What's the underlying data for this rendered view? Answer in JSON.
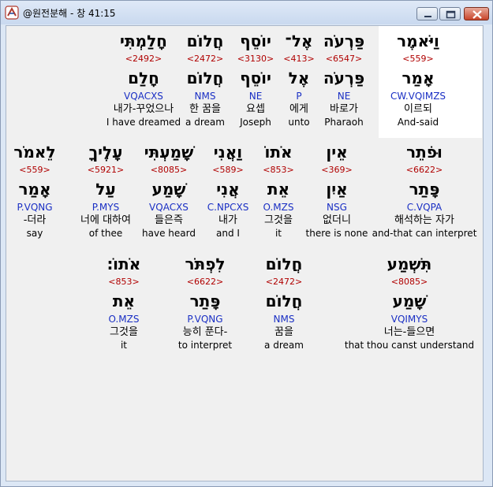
{
  "window": {
    "title": "@원전분해 - 창 41:15",
    "controls": {
      "minimize_icon": "minimize-icon",
      "maximize_icon": "maximize-icon",
      "close_icon": "close-icon"
    },
    "accent": "#c9442a"
  },
  "colors": {
    "strong": "#b00000",
    "parse": "#1a2fc4",
    "highlight": "#ffffff"
  },
  "rows": [
    [
      {
        "heb": "וַיֹּאמֶר",
        "num": "<559>",
        "lemma": "אָמַר",
        "parse": "CW.VQIMZS",
        "kor": "이르되",
        "eng": "And-said",
        "selected": true
      },
      {
        "heb": "פַּרְעֹה",
        "num": "<6547>",
        "lemma": "פַּרְעֹה",
        "parse": "NE",
        "kor": "바로가",
        "eng": "Pharaoh"
      },
      {
        "heb": "אֶל־",
        "num": "<413>",
        "lemma": "אֶל",
        "parse": "P",
        "kor": "에게",
        "eng": "unto"
      },
      {
        "heb": "יוֹסֵף",
        "num": "<3130>",
        "lemma": "יוֹסֵף",
        "parse": "NE",
        "kor": "요셉",
        "eng": "Joseph"
      },
      {
        "heb": "חֲלוֹם",
        "num": "<2472>",
        "lemma": "חֲלוֹם",
        "parse": "NMS",
        "kor": "한 꿈을",
        "eng": "a dream"
      },
      {
        "heb": "חָלַמְתִּי",
        "num": "<2492>",
        "lemma": "חָלַם",
        "parse": "VQACXS",
        "kor": "내가-꾸었으나",
        "eng": "I have dreamed"
      }
    ],
    [
      {
        "heb": "וּפֹתֵר",
        "num": "<6622>",
        "lemma": "פָּתַר",
        "parse": "C.VQPA",
        "kor": "해석하는 자가",
        "eng": "and-that can interpret"
      },
      {
        "heb": "אֵין",
        "num": "<369>",
        "lemma": "אַיִן",
        "parse": "NSG",
        "kor": "없더니",
        "eng": "there is none"
      },
      {
        "heb": "אֹתוֹ",
        "num": "<853>",
        "lemma": "אֵת",
        "parse": "O.MZS",
        "kor": "그것을",
        "eng": "it"
      },
      {
        "heb": "וַאֲנִי",
        "num": "<589>",
        "lemma": "אֲנִי",
        "parse": "C.NPCXS",
        "kor": "내가",
        "eng": "and I"
      },
      {
        "heb": "שָׁמַעְתִּי",
        "num": "<8085>",
        "lemma": "שָׁמַע",
        "parse": "VQACXS",
        "kor": "들은즉",
        "eng": "have heard"
      },
      {
        "heb": "עָלֶיךָ",
        "num": "<5921>",
        "lemma": "עַל",
        "parse": "P.MYS",
        "kor": "너에 대하여",
        "eng": "of thee"
      },
      {
        "heb": "לֵאמֹר",
        "num": "<559>",
        "lemma": "אָמַר",
        "parse": "P.VQNG",
        "kor": "-더라",
        "eng": "say"
      }
    ],
    [
      {
        "heb": "תִּשְׁמַע",
        "num": "<8085>",
        "lemma": "שָׁמַע",
        "parse": "VQIMYS",
        "kor": "너는-들으면",
        "eng": "that thou canst understand"
      },
      {
        "heb": "חֲלוֹם",
        "num": "<2472>",
        "lemma": "חֲלוֹם",
        "parse": "NMS",
        "kor": "꿈을",
        "eng": "a dream"
      },
      {
        "heb": "לִפְתֹּר",
        "num": "<6622>",
        "lemma": "פָּתַר",
        "parse": "P.VQNG",
        "kor": "능히 푼다-",
        "eng": "to interpret"
      },
      {
        "heb": "אֹתוֹ׃",
        "num": "<853>",
        "lemma": "אֵת",
        "parse": "O.MZS",
        "kor": "그것을",
        "eng": "it"
      }
    ]
  ]
}
